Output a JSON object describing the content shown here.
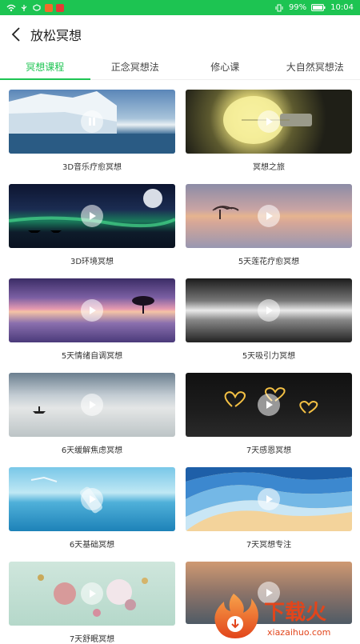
{
  "status_bar": {
    "battery": "99%",
    "time": "10:04"
  },
  "header": {
    "title": "放松冥想"
  },
  "tabs": [
    {
      "label": "冥想课程",
      "active": true
    },
    {
      "label": "正念冥想法",
      "active": false
    },
    {
      "label": "修心课",
      "active": false
    },
    {
      "label": "大自然冥想法",
      "active": false
    }
  ],
  "courses": [
    {
      "label": "3D音乐疗愈冥想"
    },
    {
      "label": "冥想之旅"
    },
    {
      "label": "3D环境冥想"
    },
    {
      "label": "5天莲花疗愈冥想"
    },
    {
      "label": "5天情绪自调冥想"
    },
    {
      "label": "5天吸引力冥想"
    },
    {
      "label": "6天缓解焦虑冥想"
    },
    {
      "label": "7天感恩冥想"
    },
    {
      "label": "6天基础冥想"
    },
    {
      "label": "7天冥想专注"
    },
    {
      "label": "7天舒眠冥想"
    },
    {
      "label": ""
    }
  ],
  "watermark": {
    "text": "下载火",
    "url_text": "xiazaihuo.com"
  }
}
